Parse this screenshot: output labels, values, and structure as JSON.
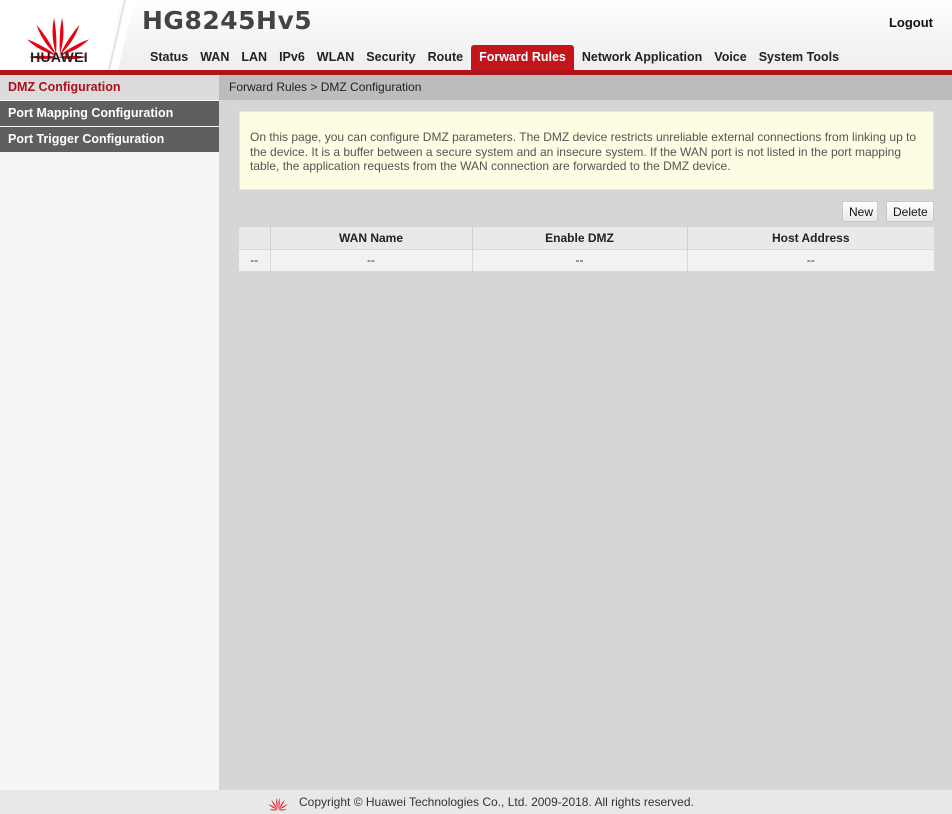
{
  "brand": {
    "logo_text": "HUAWEI",
    "model": "HG8245Hv5"
  },
  "header": {
    "logout_label": "Logout"
  },
  "nav": [
    {
      "label": "Status"
    },
    {
      "label": "WAN"
    },
    {
      "label": "LAN"
    },
    {
      "label": "IPv6"
    },
    {
      "label": "WLAN"
    },
    {
      "label": "Security"
    },
    {
      "label": "Route"
    },
    {
      "label": "Forward Rules",
      "active": true
    },
    {
      "label": "Network Application"
    },
    {
      "label": "Voice"
    },
    {
      "label": "System Tools"
    }
  ],
  "sidebar": {
    "items": [
      {
        "label": "DMZ Configuration",
        "active": true
      },
      {
        "label": "Port Mapping Configuration"
      },
      {
        "label": "Port Trigger Configuration"
      }
    ]
  },
  "breadcrumb": "Forward Rules > DMZ Configuration",
  "info_text": "On this page, you can configure DMZ parameters. The DMZ device restricts unreliable external connections from linking up to the device. It is a buffer between a secure system and an insecure system. If the WAN port is not listed in the port mapping table, the application requests from the WAN connection are forwarded to the DMZ device.",
  "buttons": {
    "new_label": "New",
    "delete_label": "Delete"
  },
  "table": {
    "headers": [
      "",
      "WAN Name",
      "Enable DMZ",
      "Host Address"
    ],
    "rows": [
      [
        "--",
        "--",
        "--",
        "--"
      ]
    ]
  },
  "footer": {
    "copyright": "Copyright © Huawei Technologies Co., Ltd. 2009-2018. All rights reserved."
  },
  "colors": {
    "brand_red": "#c4141c",
    "sidebar_dark": "#5f5f5f",
    "info_bg": "#fdfde3"
  },
  "icons": {
    "logo": "huawei-flower-icon"
  }
}
